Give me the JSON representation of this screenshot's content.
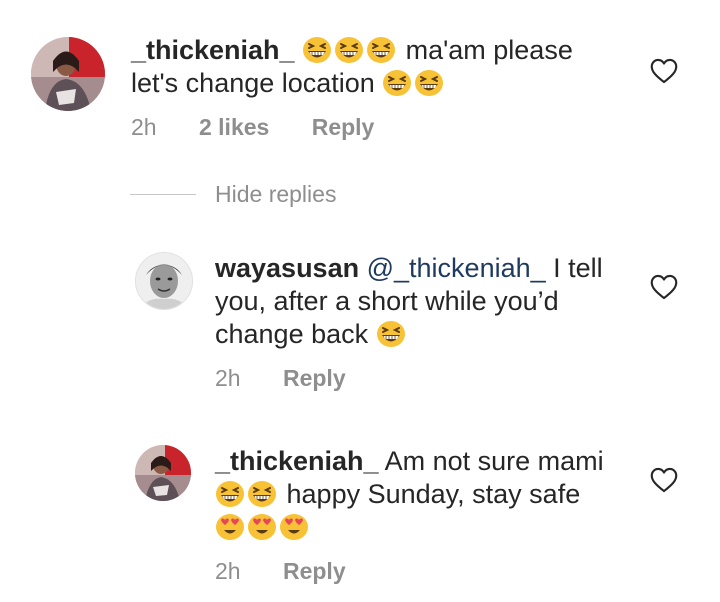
{
  "comments": [
    {
      "username": "_thickeniah_",
      "line1_text": "ma'am please",
      "line2_text": "let's change location",
      "time": "2h",
      "likes": "2 likes",
      "reply": "Reply"
    }
  ],
  "hide_replies": "Hide replies",
  "replies": [
    {
      "username": "wayasusan",
      "mention": "@_thickeniah_",
      "line1_text": "I tell",
      "line2_text": "you, after a short while you’d",
      "line3_text": "change back",
      "time": "2h",
      "reply": "Reply"
    },
    {
      "username": "_thickeniah_",
      "line1_text": "Am not sure mami",
      "line2_text": "happy Sunday, stay safe",
      "time": "2h",
      "reply": "Reply"
    }
  ],
  "icons": {
    "laugh": "grinning-squinting-face-emoji",
    "hearts": "smiling-face-with-heart-eyes-emoji",
    "like": "heart-outline-icon"
  },
  "colors": {
    "text": "#262626",
    "meta": "#8e8e8e",
    "emoji_yellow": "#f7c236",
    "heart_eye": "#e8455a"
  }
}
